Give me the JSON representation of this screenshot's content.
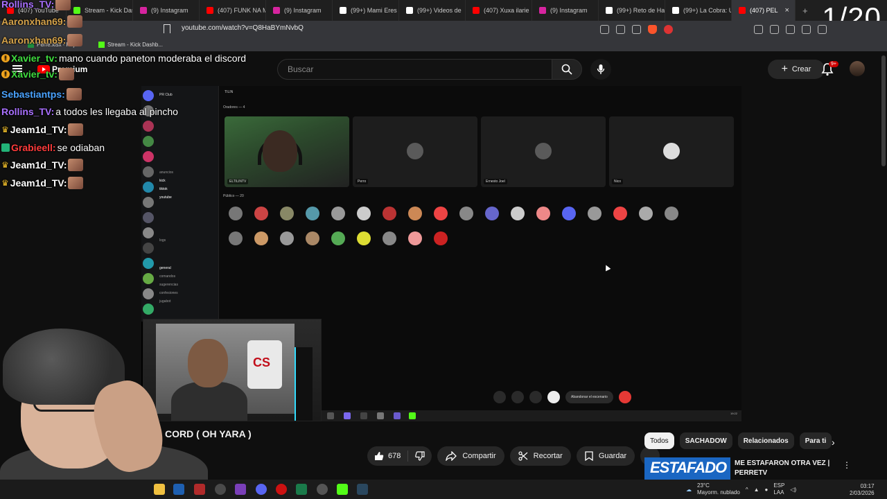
{
  "browser": {
    "tabs": [
      {
        "label": "(407) YouTube",
        "icon": "youtube-icon",
        "color": "#ff0000"
      },
      {
        "label": "Stream - Kick Das",
        "icon": "kick-icon",
        "color": "#53fc18"
      },
      {
        "label": "(9) Instagram",
        "icon": "instagram-icon",
        "color": "#d6249f"
      },
      {
        "label": "(407) FUNK NA M",
        "icon": "youtube-icon",
        "color": "#ff0000"
      },
      {
        "label": "(9) Instagram",
        "icon": "instagram-icon",
        "color": "#d6249f"
      },
      {
        "label": "(99+) Mami Eres",
        "icon": "tiktok-icon",
        "color": "#ffffff"
      },
      {
        "label": "(99+) Videos de",
        "icon": "tiktok-icon",
        "color": "#ffffff"
      },
      {
        "label": "(407) Xuxa ilarie",
        "icon": "youtube-icon",
        "color": "#ff0000"
      },
      {
        "label": "(9) Instagram",
        "icon": "instagram-icon",
        "color": "#d6249f"
      },
      {
        "label": "(99+) Reto de Ha",
        "icon": "tiktok-icon",
        "color": "#ffffff"
      },
      {
        "label": "(99+) La Cobra: U",
        "icon": "tiktok-icon",
        "color": "#ffffff"
      },
      {
        "label": "(407) PEL",
        "icon": "youtube-icon",
        "color": "#ff0000",
        "active": true
      }
    ],
    "new_tab": "+",
    "url": "youtube.com/watch?v=Q8HaBYmNvbQ",
    "bookmarks": [
      {
        "label": "Perre.xlsx - Hoja",
        "icon": "sheets-icon",
        "color": "#1e8e3e"
      },
      {
        "label": "Stream - Kick Dashb...",
        "icon": "kick-icon",
        "color": "#53fc18"
      }
    ]
  },
  "overlay": {
    "counter": "1/20"
  },
  "youtube": {
    "logo_text": "Premium",
    "search_placeholder": "Buscar",
    "create_label": "Crear",
    "notif_badge": "9+",
    "video_title": "CORD ( OH YARA )",
    "likes": "678",
    "actions": {
      "share": "Compartir",
      "clip": "Recortar",
      "save": "Guardar",
      "more": "..."
    },
    "chips": [
      "Todos",
      "SACHADOW",
      "Relacionados",
      "Para ti"
    ],
    "recommendation": {
      "thumb_text": "ESTAFADO",
      "title_line1": "ME ESTAFARON OTRA VEZ |",
      "title_line2": "PERRETV"
    }
  },
  "chat": [
    {
      "user": "Rollins_TV:",
      "color": "#a970ff",
      "text": "",
      "badge": "none",
      "emote": true
    },
    {
      "user": "Aaronxhan69:",
      "color": "#d4a24a",
      "text": "",
      "badge": "none",
      "emote": true
    },
    {
      "user": "Aaronxhan69:",
      "color": "#d4a24a",
      "text": "",
      "badge": "none",
      "emote": true
    },
    {
      "user": "Xavier_tv:",
      "color": "#3fdc3f",
      "text": "mano cuando paneton moderaba el discord",
      "badge": "mod",
      "emote": false
    },
    {
      "user": "Xavier_tv:",
      "color": "#3fdc3f",
      "text": "",
      "badge": "mod",
      "emote": true
    },
    {
      "user": "Sebastiantps:",
      "color": "#4aa3ff",
      "text": "",
      "badge": "none",
      "emote": true
    },
    {
      "user": "Rollins_TV:",
      "color": "#a970ff",
      "text": "a todos les llegaba al pincho",
      "badge": "none",
      "emote": false
    },
    {
      "user": "Jeam1d_TV:",
      "color": "#ffffff",
      "text": "",
      "badge": "crown",
      "emote": true
    },
    {
      "user": "Grabieell:",
      "color": "#ff3b3b",
      "text": "se odiaban",
      "badge": "sub",
      "emote": false
    },
    {
      "user": "Jeam1d_TV:",
      "color": "#ffffff",
      "text": "",
      "badge": "crown",
      "emote": true
    },
    {
      "user": "Jeam1d_TV:",
      "color": "#ffffff",
      "text": "",
      "badge": "crown",
      "emote": true
    }
  ],
  "discord": {
    "server": "PR Club",
    "stage_header": "TILIN",
    "speakers_header": "Oradores — 4",
    "audience_header": "Público — 20",
    "speakers": [
      {
        "name": "ELTILINTV",
        "type": "camera"
      },
      {
        "name": "Perro",
        "type": "avatar"
      },
      {
        "name": "Ernesto Joel",
        "type": "avatar"
      },
      {
        "name": "Nico",
        "type": "avatar"
      }
    ],
    "channels": [
      "anuncios",
      "kick",
      "tiktok",
      "youtube",
      "logs",
      "general",
      "comandos",
      "sugerencias",
      "confesiones",
      "jugabot"
    ],
    "leave_button": "Abandonar el escenario",
    "clock": "19:22"
  },
  "taskbar": {
    "weather_temp": "23°C",
    "weather_desc": "Mayorm. nublado",
    "lang_top": "ESP",
    "lang_bottom": "LAA",
    "time": "03:17",
    "date": "2/03/2026"
  }
}
